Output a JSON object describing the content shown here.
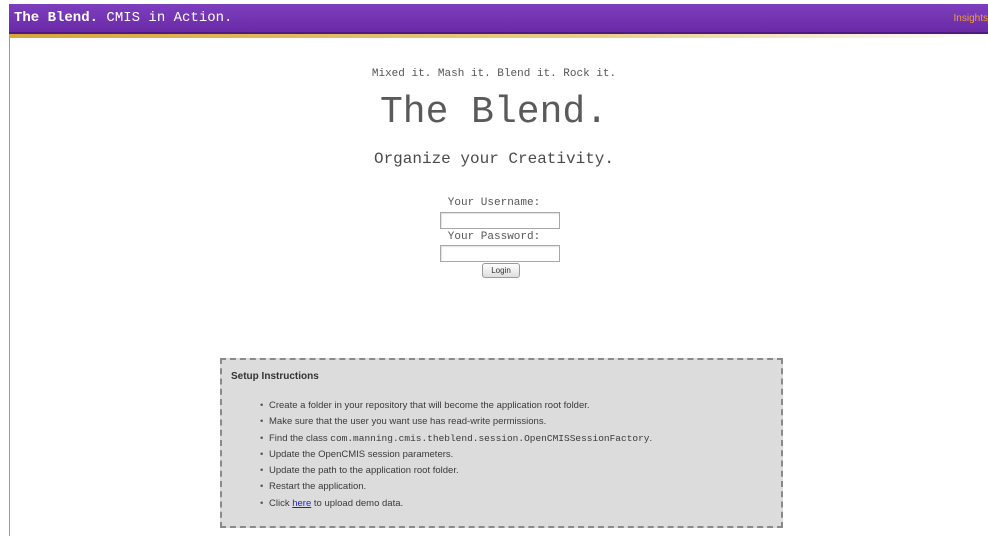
{
  "header": {
    "brand_bold": "The Blend.",
    "brand_rest": "CMIS in Action.",
    "right_link": "Insights"
  },
  "hero": {
    "tagline": "Mixed it. Mash it. Blend it. Rock it.",
    "title": "The Blend.",
    "subtitle": "Organize your Creativity."
  },
  "login_form": {
    "username_label": "Your Username:",
    "username_value": "",
    "password_label": "Your Password:",
    "password_value": "",
    "login_button": "Login"
  },
  "setup": {
    "heading": "Setup Instructions",
    "steps": [
      {
        "text": "Create a folder in your repository that will become the application root folder."
      },
      {
        "text": "Make sure that the user you want use has read-write permissions."
      },
      {
        "prefix": "Find the class ",
        "code": "com.manning.cmis.theblend.session.OpenCMISSessionFactory",
        "suffix": "."
      },
      {
        "text": "Update the OpenCMIS session parameters."
      },
      {
        "text": "Update the path to the application root folder."
      },
      {
        "text": "Restart the application."
      },
      {
        "prefix": "Click ",
        "link": "here",
        "suffix": " to upload demo data."
      }
    ]
  }
}
